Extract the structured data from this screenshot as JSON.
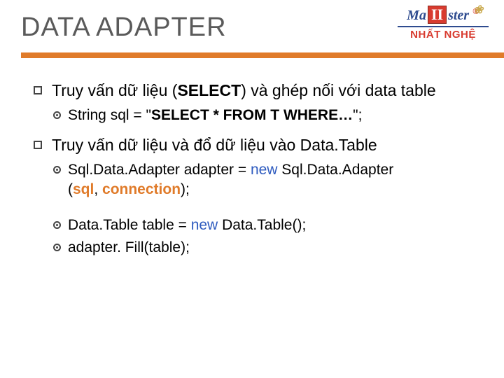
{
  "logo": {
    "left": "Ma",
    "mid": "II",
    "right": "ster",
    "reg": "®",
    "sub": "NHẤT NGHỆ"
  },
  "title": "DATA ADAPTER",
  "b1": {
    "pre": "Truy vấn dữ liệu (",
    "sel": "SELECT",
    "post": ") và ghép nối với data table"
  },
  "b1a": {
    "pre": "String sql = \"",
    "mid": "SELECT * FROM T WHERE…",
    "post": "\";"
  },
  "b2": "Truy vấn dữ liệu và đổ dữ liệu vào Data.Table",
  "b2a": {
    "t1": "Sql.Data.Adapter",
    "t2": "  adapter = ",
    "t3": "new",
    "t4": " Sql.Data.Adapter",
    "t5": "(",
    "t6": "sql",
    "t7": ", ",
    "t8": "connection",
    "t9": ");"
  },
  "b2b": {
    "t1": "Data.Table table = ",
    "t2": "new",
    "t3": " Data.Table();"
  },
  "b2c": "adapter. Fill(table);"
}
